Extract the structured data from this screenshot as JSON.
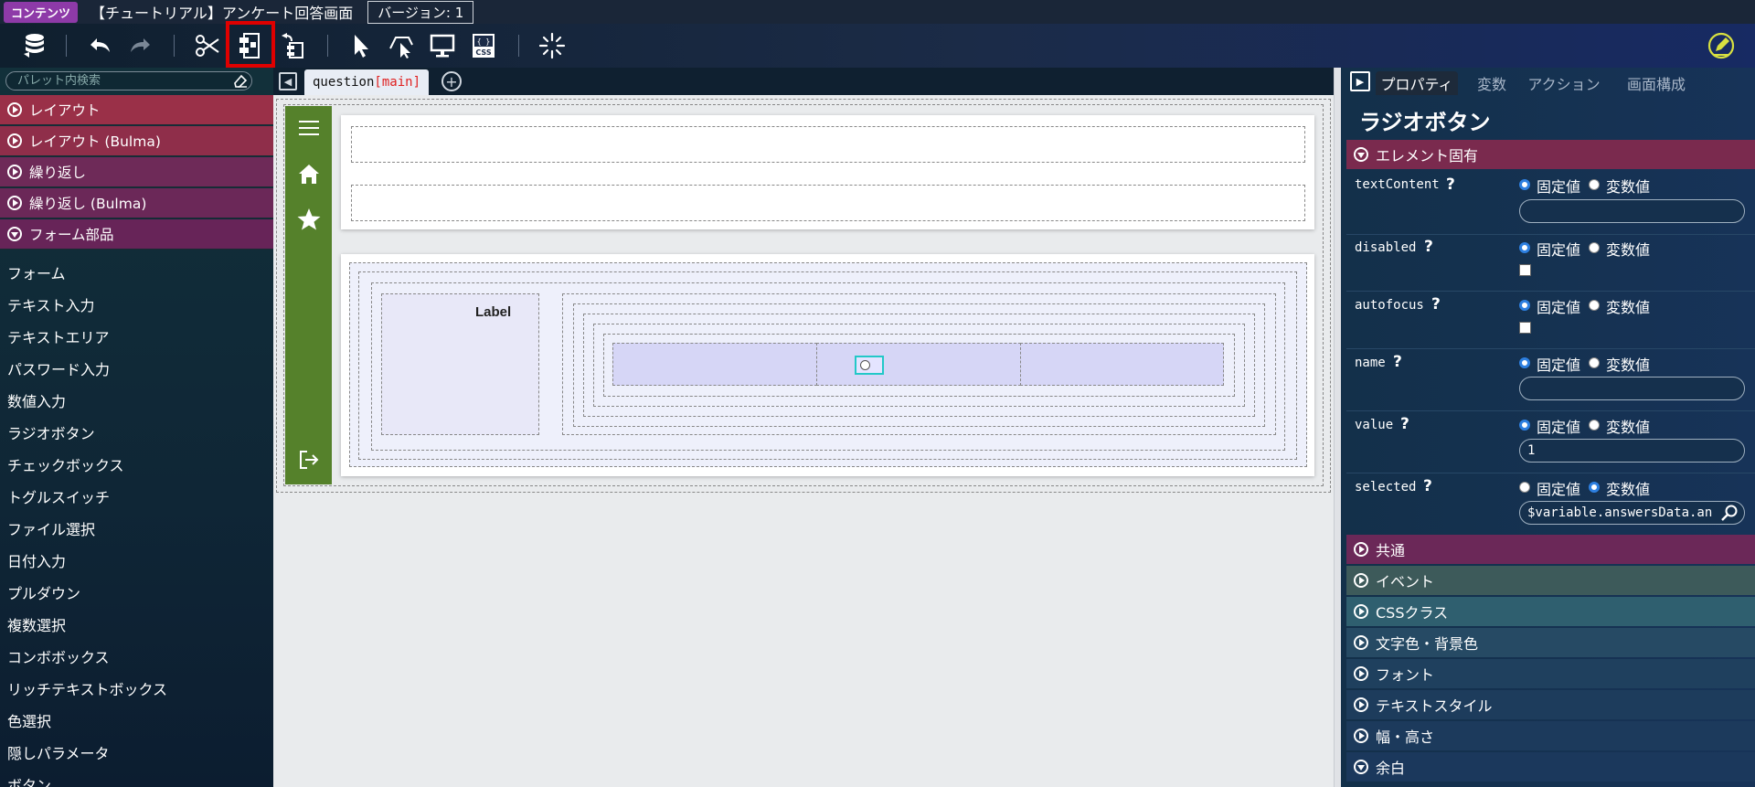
{
  "titlebar": {
    "badge": "コンテンツ",
    "title": "【チュートリアル】アンケート回答画面",
    "version": "バージョン: 1"
  },
  "toolbar": {
    "icons": [
      "database-icon",
      "undo-icon",
      "redo-icon",
      "cut-icon",
      "component-icon",
      "extract-component-icon",
      "select-icon",
      "select-area-icon",
      "preview-icon",
      "css-icon",
      "loading-icon",
      "edit-icon"
    ],
    "css_label": "CSS"
  },
  "palette": {
    "search_placeholder": "パレット内検索",
    "categories": [
      {
        "label": "レイアウト",
        "color": "#9a3048",
        "open": false
      },
      {
        "label": "レイアウト (Bulma)",
        "color": "#94304a",
        "open": false
      },
      {
        "label": "繰り返し",
        "color": "#6e2a58",
        "open": false
      },
      {
        "label": "繰り返し (Bulma)",
        "color": "#6b2858",
        "open": false
      },
      {
        "label": "フォーム部品",
        "color": "#672458",
        "open": true
      }
    ],
    "items": [
      "フォーム",
      "テキスト入力",
      "テキストエリア",
      "パスワード入力",
      "数値入力",
      "ラジオボタン",
      "チェックボックス",
      "トグルスイッチ",
      "ファイル選択",
      "日付入力",
      "プルダウン",
      "複数選択",
      "コンボボックス",
      "リッチテキストボックス",
      "色選択",
      "隠しパラメータ",
      "ボタン"
    ]
  },
  "tabs": {
    "page_name": "question",
    "page_tag": "[main]"
  },
  "canvas": {
    "label_text": "Label",
    "nav_icons": [
      "menu-icon",
      "home-icon",
      "star-icon",
      "logout-icon"
    ],
    "nav_color": "#55812b"
  },
  "props": {
    "tabs": [
      "プロパティ",
      "変数",
      "アクション",
      "画面構成"
    ],
    "active_tab": "プロパティ",
    "title": "ラジオボタン",
    "section_specific": "エレメント固有",
    "help_mark": "?",
    "fixed_label": "固定値",
    "variable_label": "変数値",
    "rows": [
      {
        "name": "textContent",
        "mode": "fixed",
        "value": "",
        "kind": "text"
      },
      {
        "name": "disabled",
        "mode": "fixed",
        "value": "",
        "kind": "check"
      },
      {
        "name": "autofocus",
        "mode": "fixed",
        "value": "",
        "kind": "check"
      },
      {
        "name": "name",
        "mode": "fixed",
        "value": "",
        "kind": "text"
      },
      {
        "name": "value",
        "mode": "fixed",
        "value": "1",
        "kind": "text"
      },
      {
        "name": "selected",
        "mode": "variable",
        "value": "$variable.answersData.an",
        "kind": "text"
      }
    ],
    "sections": [
      {
        "label": "共通",
        "color": "#6b2858"
      },
      {
        "label": "イベント",
        "color": "#3d5a5a"
      },
      {
        "label": "CSSクラス",
        "color": "#2f5f6f"
      },
      {
        "label": "文字色・背景色",
        "color": "#264a64"
      },
      {
        "label": "フォント",
        "color": "#1f405e"
      },
      {
        "label": "テキストスタイル",
        "color": "#1d3c5c"
      },
      {
        "label": "幅・高さ",
        "color": "#1c3a5c"
      },
      {
        "label": "余白",
        "color": "#1b385c"
      }
    ]
  }
}
